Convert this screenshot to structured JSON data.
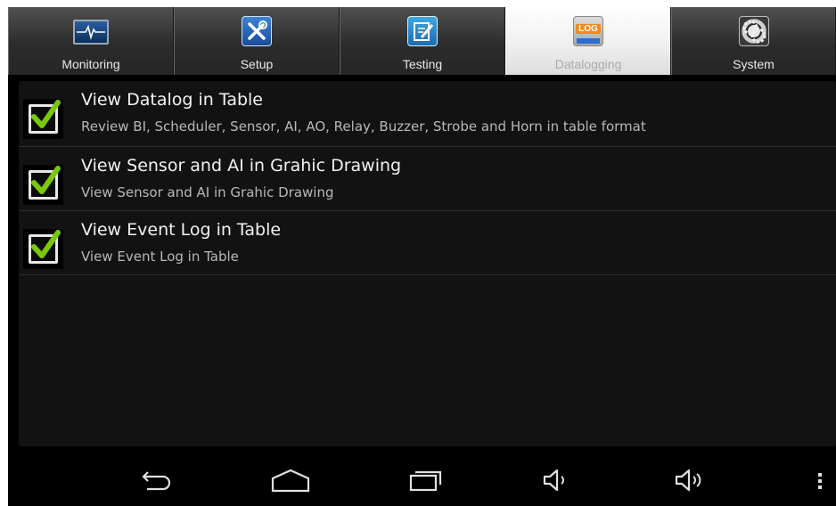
{
  "tabs": [
    {
      "label": "Monitoring",
      "icon": "monitor-heartbeat-icon",
      "active": false
    },
    {
      "label": "Setup",
      "icon": "tools-icon",
      "active": false
    },
    {
      "label": "Testing",
      "icon": "notepad-pencil-icon",
      "active": false
    },
    {
      "label": "Datalogging",
      "icon": "log-icon",
      "icon_text": "LOG",
      "active": true
    },
    {
      "label": "System",
      "icon": "gears-icon",
      "active": false
    }
  ],
  "items": [
    {
      "title": "View Datalog in Table",
      "subtitle": "Review BI, Scheduler, Sensor, AI, AO, Relay, Buzzer, Strobe and Horn in table format",
      "checked": true
    },
    {
      "title": "View Sensor and AI in Grahic Drawing",
      "subtitle": "View Sensor and AI in Grahic Drawing",
      "checked": true
    },
    {
      "title": "View Event Log in Table",
      "subtitle": "View Event Log in Table",
      "checked": true
    }
  ],
  "navbar": {
    "buttons": [
      "back-icon",
      "home-icon",
      "recent-apps-icon",
      "volume-down-icon",
      "volume-up-icon",
      "overflow-menu-icon"
    ]
  },
  "colors": {
    "check_green": "#7ac70c",
    "active_tab": "#eeeeee"
  }
}
